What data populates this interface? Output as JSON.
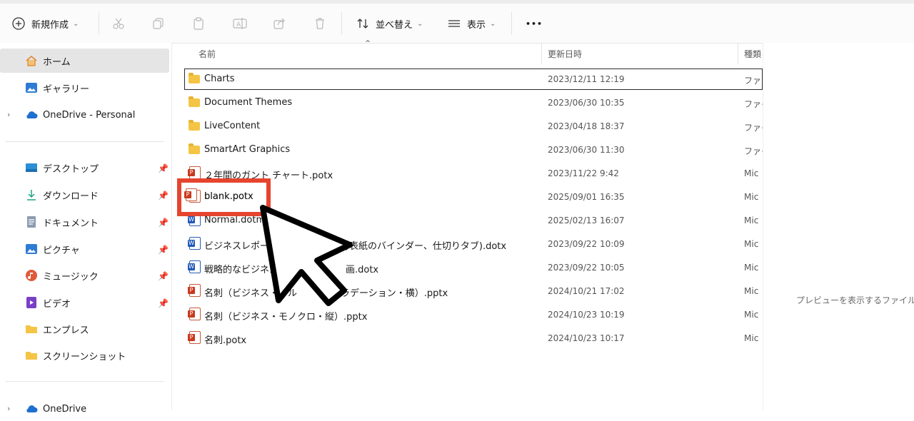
{
  "toolbar": {
    "new_label": "新規作成",
    "sort_label": "並べ替え",
    "view_label": "表示",
    "more_label": "•••"
  },
  "nav": {
    "home": "ホーム",
    "gallery": "ギャラリー",
    "onedrive_personal": "OneDrive - Personal",
    "desktop": "デスクトップ",
    "downloads": "ダウンロード",
    "documents": "ドキュメント",
    "pictures": "ピクチャ",
    "music": "ミュージック",
    "videos": "ビデオ",
    "templates": "エンプレス",
    "screenshots": "スクリーンショット",
    "onedrive": "OneDrive"
  },
  "columns": {
    "name": "名前",
    "modified": "更新日時",
    "type": "種類"
  },
  "files": [
    {
      "name": "Charts",
      "date": "2023/12/11 12:19",
      "type": "ファイ"
    },
    {
      "name": "Document Themes",
      "date": "2023/06/30 10:35",
      "type": "ファイ"
    },
    {
      "name": "LiveContent",
      "date": "2023/04/18 18:37",
      "type": "ファイ"
    },
    {
      "name": "SmartArt Graphics",
      "date": "2023/06/30 11:30",
      "type": "ファイ"
    },
    {
      "name": "２年間のガント チャート.potx",
      "date": "2023/11/22 9:42",
      "type": "Mic"
    },
    {
      "name": "blank.potx",
      "date": "2025/09/01 16:35",
      "type": "Mic"
    },
    {
      "name": "Normal.dotm",
      "date": "2025/02/13 16:07",
      "type": "Mic"
    },
    {
      "name": "ビジネスレポート用",
      "name_tail": "背表紙のバインダー、仕切りタブ).dotx",
      "date": "2023/09/22 10:09",
      "type": "Mic"
    },
    {
      "name": "戦略的なビジネス",
      "name_tail": "画.dotx",
      "date": "2023/09/22 10:05",
      "type": "Mic"
    },
    {
      "name": "名刺（ビジネス・ブル",
      "name_tail": "グラデーション・横）.pptx",
      "date": "2024/10/21 17:02",
      "type": "Mic"
    },
    {
      "name": "名刺（ビジネス・モノクロ・縦）.pptx",
      "date": "2024/10/23 10:19",
      "type": "Mic"
    },
    {
      "name": "名刺.potx",
      "date": "2024/10/23 10:17",
      "type": "Mic"
    }
  ],
  "preview": {
    "text": "プレビューを表示するファイルを選"
  },
  "highlight": {
    "label": "blank.potx"
  },
  "colors": {
    "highlight": "#e5442e",
    "selection": "#e5e5e5",
    "folder": "#f4c545"
  }
}
